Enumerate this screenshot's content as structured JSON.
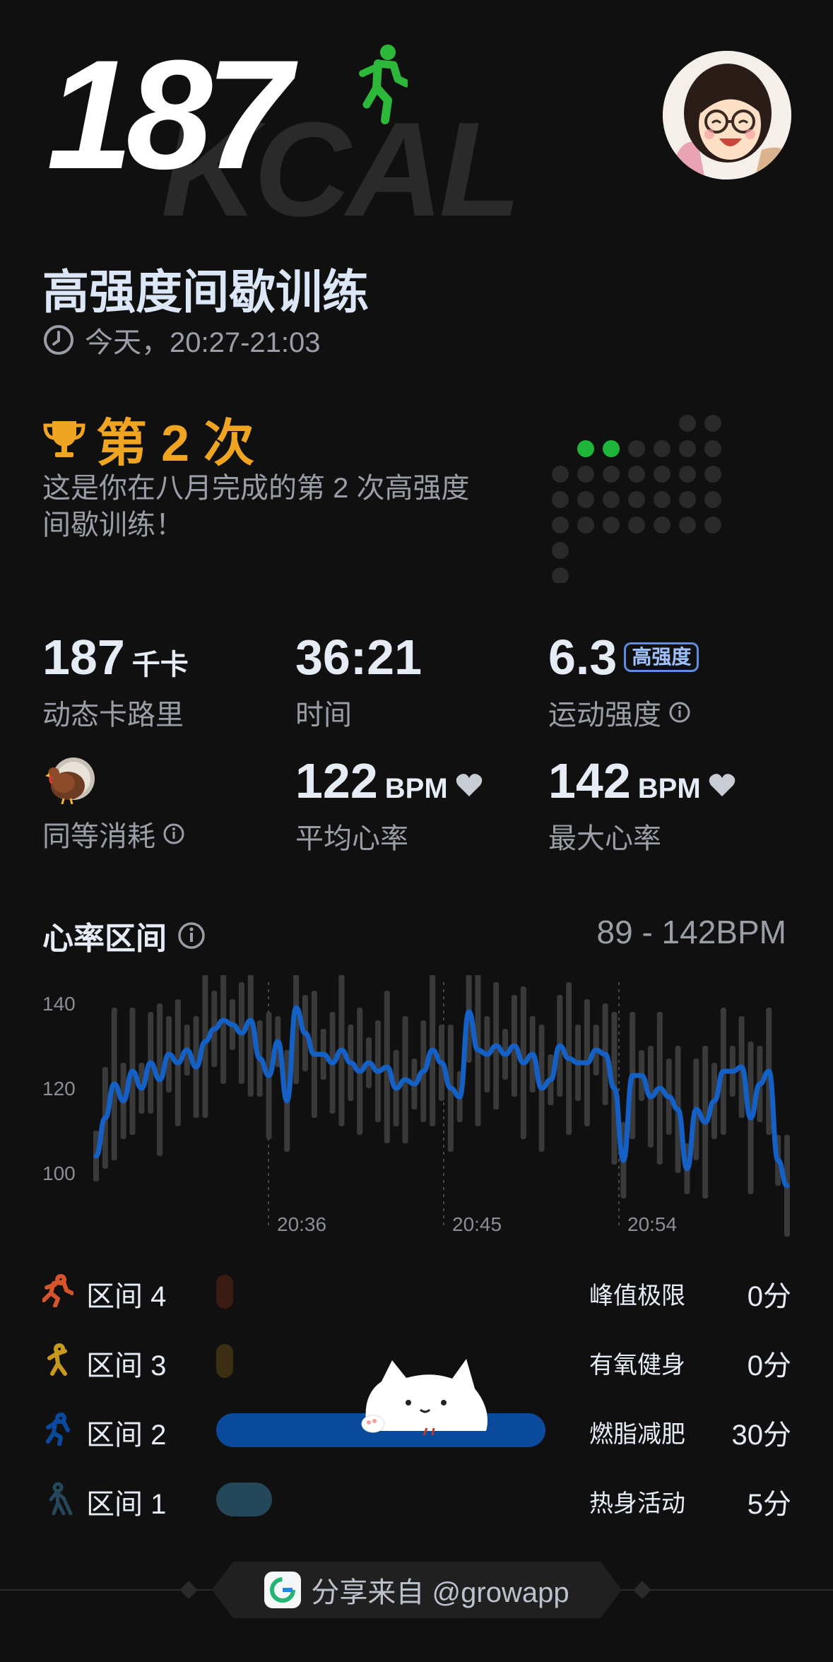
{
  "header": {
    "calories_big": "187",
    "kcal_watermark": "KCAL",
    "workout_title": "高强度间歇训练",
    "time_text": "今天，20:27-21:03"
  },
  "achievement": {
    "headline": "第 2 次",
    "description": "这是你在八月完成的第 2 次高强度间歇训练！"
  },
  "stats": {
    "calories": {
      "value": "187",
      "unit": "千卡",
      "label": "动态卡路里"
    },
    "duration": {
      "value": "36:21",
      "label": "时间"
    },
    "intensity": {
      "value": "6.3",
      "badge": "高强度",
      "label": "运动强度"
    },
    "equivalent": {
      "label": "同等消耗"
    },
    "avg_hr": {
      "value": "122",
      "unit": "BPM",
      "label": "平均心率"
    },
    "max_hr": {
      "value": "142",
      "unit": "BPM",
      "label": "最大心率"
    }
  },
  "heart_rate": {
    "title": "心率区间",
    "range": "89 - 142BPM"
  },
  "chart_data": {
    "type": "line",
    "x_ticks": [
      "20:36",
      "20:45",
      "20:54"
    ],
    "y_ticks": [
      "140",
      "120",
      "100"
    ],
    "ylim": [
      90,
      145
    ],
    "series": [
      {
        "values": [
          104,
          113,
          121,
          117,
          124,
          120,
          126,
          122,
          128,
          126,
          129,
          125,
          131,
          134,
          136,
          135,
          133,
          136,
          127,
          123,
          131,
          117,
          139,
          133,
          128,
          128,
          126,
          129,
          126,
          124,
          126,
          124,
          125,
          120,
          122,
          121,
          124,
          129,
          126,
          120,
          118,
          138,
          129,
          128,
          130,
          128,
          130,
          126,
          128,
          120,
          122,
          130,
          127,
          126,
          126,
          129,
          128,
          120,
          103,
          123,
          123,
          118,
          120,
          118,
          115,
          101,
          115,
          112,
          117,
          124,
          124,
          125,
          113,
          121,
          124,
          103,
          97
        ]
      }
    ]
  },
  "zones": [
    {
      "label": "区间 4",
      "name": "峰值极限",
      "minutes": "0分",
      "fraction": 0,
      "color": "#d6542b"
    },
    {
      "label": "区间 3",
      "name": "有氧健身",
      "minutes": "0分",
      "fraction": 0,
      "color": "#c89a1c"
    },
    {
      "label": "区间 2",
      "name": "燃脂减肥",
      "minutes": "30分",
      "fraction": 1.0,
      "color": "#0a4a9c"
    },
    {
      "label": "区间 1",
      "name": "热身活动",
      "minutes": "5分",
      "fraction": 0.17,
      "color": "#25475a"
    }
  ],
  "footer": {
    "share_text": "分享来自 @growapp"
  },
  "icons": {
    "runner": "running-person-icon",
    "clock": "clock-icon",
    "trophy": "trophy-icon",
    "info": "info-icon",
    "heart": "heart-icon",
    "turkey": "turkey-icon"
  }
}
